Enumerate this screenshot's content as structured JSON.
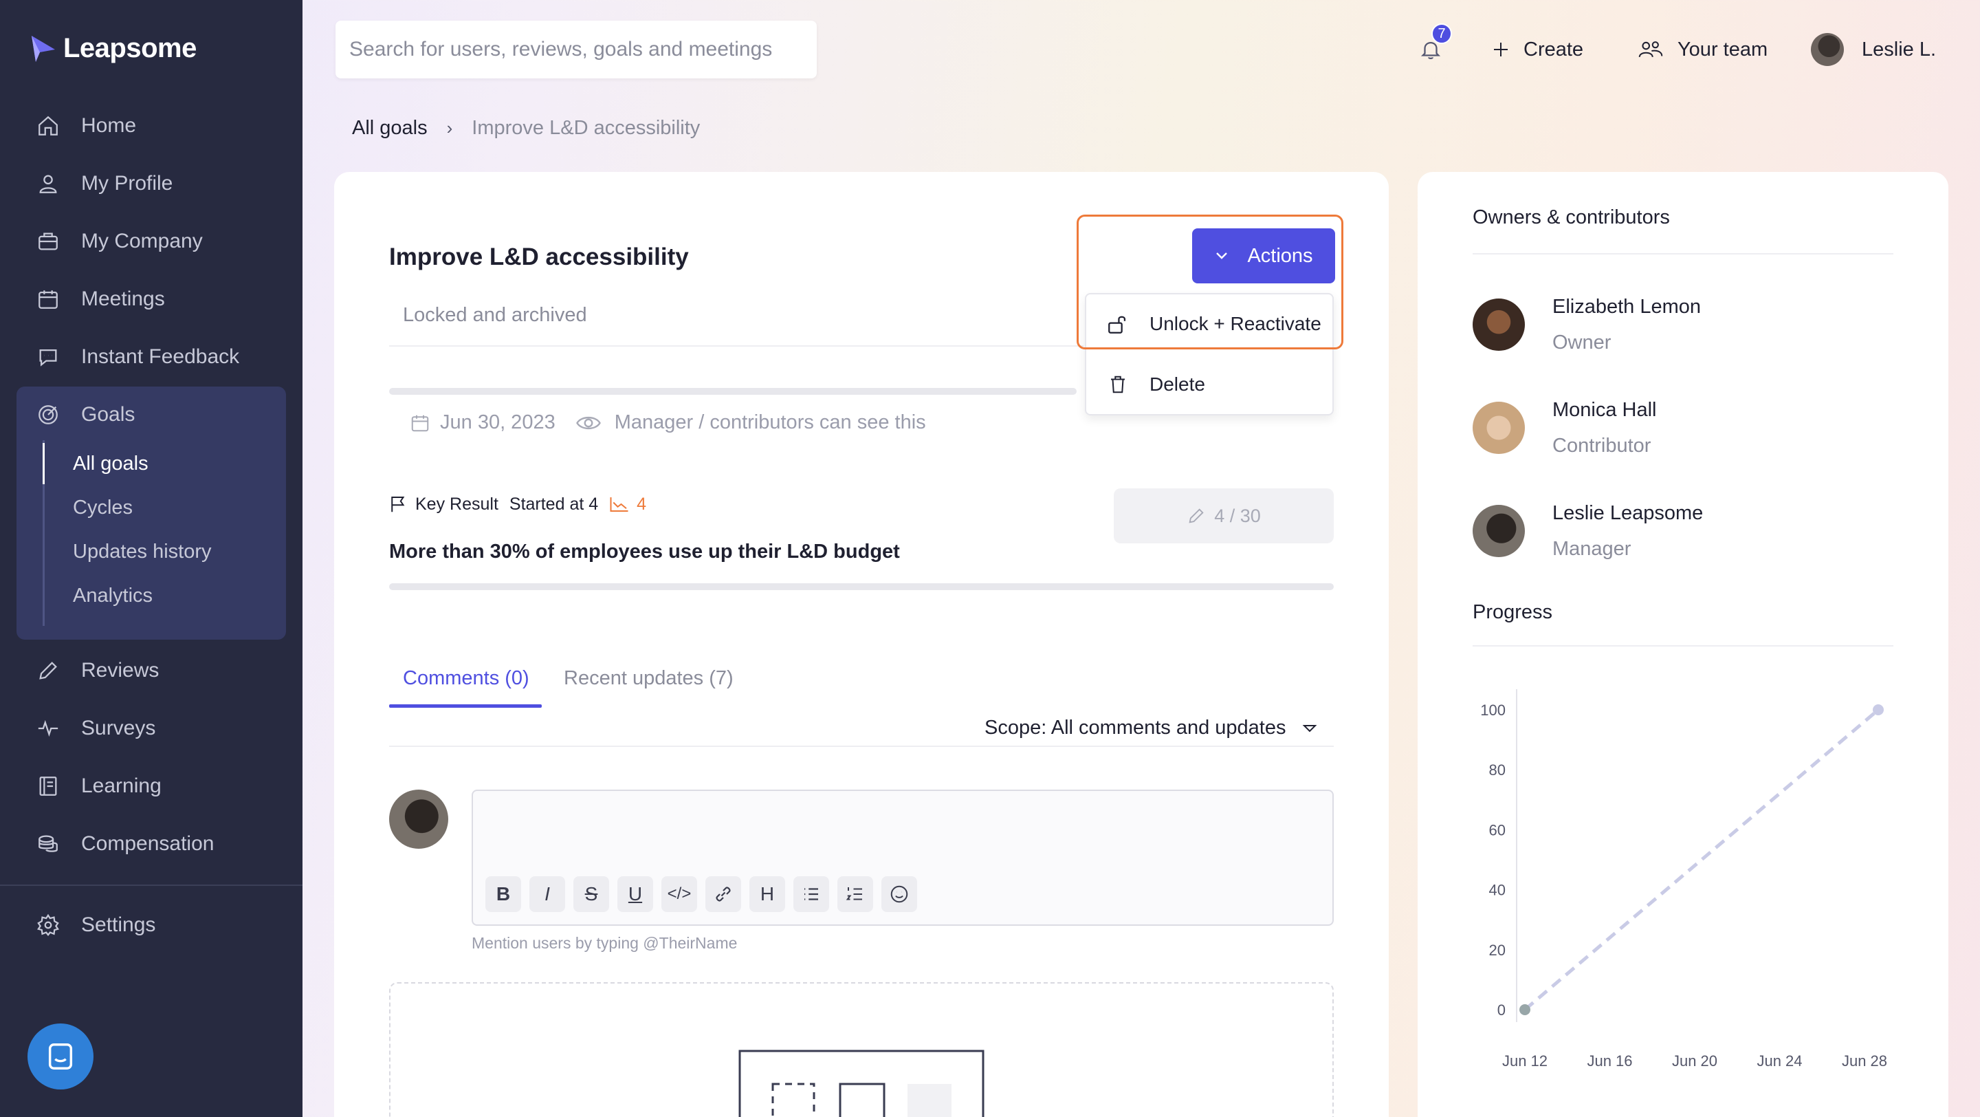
{
  "app": {
    "name": "Leapsome"
  },
  "search": {
    "placeholder": "Search for users, reviews, goals and meetings"
  },
  "header": {
    "notifications_count": "7",
    "create_label": "Create",
    "team_label": "Your team",
    "user_label": "Leslie L."
  },
  "sidebar": {
    "items": [
      {
        "label": "Home",
        "icon": "home-icon"
      },
      {
        "label": "My Profile",
        "icon": "user-icon"
      },
      {
        "label": "My Company",
        "icon": "briefcase-icon"
      },
      {
        "label": "Meetings",
        "icon": "calendar-icon"
      },
      {
        "label": "Instant Feedback",
        "icon": "chat-bubble-icon"
      },
      {
        "label": "Goals",
        "icon": "target-icon"
      },
      {
        "label": "Reviews",
        "icon": "pencil-icon"
      },
      {
        "label": "Surveys",
        "icon": "pulse-icon"
      },
      {
        "label": "Learning",
        "icon": "book-icon"
      },
      {
        "label": "Compensation",
        "icon": "coins-icon"
      },
      {
        "label": "Settings",
        "icon": "gear-icon"
      }
    ],
    "goals_sub": [
      "All goals",
      "Cycles",
      "Updates history",
      "Analytics"
    ]
  },
  "breadcrumb": {
    "root": "All goals",
    "current": "Improve L&D accessibility"
  },
  "goal": {
    "title": "Improve L&D accessibility",
    "status": "Locked and archived",
    "due_date": "Jun 30, 2023",
    "visibility": "Manager / contributors can see this"
  },
  "actions": {
    "button_label": "Actions",
    "menu": [
      "Unlock + Reactivate",
      "Delete"
    ]
  },
  "key_result": {
    "type_label": "Key Result",
    "started_label": "Started at 4",
    "current_value": "4",
    "title": "More than 30% of employees use up their L&D budget",
    "progress_label": "4 / 30"
  },
  "tabs": {
    "comments": "Comments (0)",
    "updates": "Recent updates (7)"
  },
  "scope": {
    "label": "Scope: All comments and updates"
  },
  "editor": {
    "toolbar": [
      "B",
      "I",
      "S",
      "U",
      "</>",
      "link",
      "H",
      "bullets",
      "numbers",
      "emoji"
    ],
    "hint": "Mention users by typing @TheirName"
  },
  "right_panel": {
    "title": "Owners & contributors",
    "people": [
      {
        "name": "Elizabeth Lemon",
        "role": "Owner"
      },
      {
        "name": "Monica Hall",
        "role": "Contributor"
      },
      {
        "name": "Leslie Leapsome",
        "role": "Manager"
      }
    ],
    "progress_title": "Progress"
  },
  "chart_data": {
    "type": "line",
    "x": [
      "Jun 12",
      "Jun 28"
    ],
    "x_ticks": [
      "Jun 12",
      "Jun 16",
      "Jun 20",
      "Jun 24",
      "Jun 28"
    ],
    "y_ticks": [
      "100",
      "80",
      "60",
      "40",
      "20",
      "0"
    ],
    "ylim": [
      0,
      100
    ],
    "series": [
      {
        "values": [
          0,
          100
        ],
        "style": "dashed",
        "color": "#c9cbe6"
      }
    ],
    "grid": false
  },
  "colors": {
    "accent": "#4f4fe0",
    "sidebar": "#272a40",
    "highlight": "#ee7a3a"
  }
}
